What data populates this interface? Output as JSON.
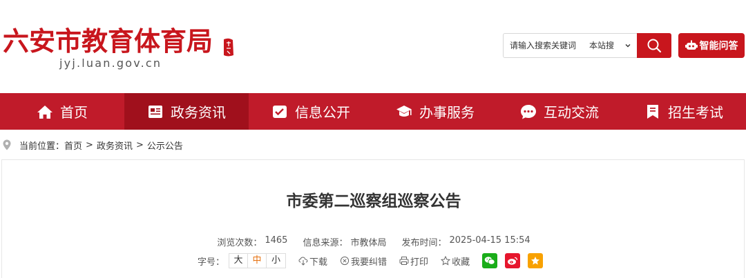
{
  "site": {
    "title": "六安市教育体育局",
    "url": "jyj.luan.gov.cn",
    "seal_text": "六安"
  },
  "search": {
    "placeholder": "请输入搜索关键词",
    "scope": "本站搜",
    "button_icon": "search-icon"
  },
  "ai_button": {
    "label": "智能问答",
    "icon": "robot-icon"
  },
  "nav": {
    "items": [
      {
        "label": "首页",
        "icon": "home-icon",
        "active": false
      },
      {
        "label": "政务资讯",
        "icon": "newspaper-icon",
        "active": true
      },
      {
        "label": "信息公开",
        "icon": "check-card-icon",
        "active": false
      },
      {
        "label": "办事服务",
        "icon": "graduation-cap-icon",
        "active": false
      },
      {
        "label": "互动交流",
        "icon": "chat-bubble-icon",
        "active": false
      },
      {
        "label": "招生考试",
        "icon": "bookmark-icon",
        "active": false
      }
    ]
  },
  "breadcrumb": {
    "prefix": "当前位置：",
    "items": [
      "首页",
      "政务资讯",
      "公示公告"
    ],
    "separator": ">"
  },
  "article": {
    "title": "市委第二巡察组巡察公告",
    "views_label": "浏览次数：",
    "views": "1465",
    "source_label": "信息来源：",
    "source": "市教体局",
    "time_label": "发布时间：",
    "time": "2025-04-15 15:54"
  },
  "tools": {
    "font_size_label": "字号：",
    "font_sizes": [
      "大",
      "中",
      "小"
    ],
    "font_size_selected": "中",
    "download": "下载",
    "correct": "我要纠错",
    "print": "打印",
    "favorite": "收藏",
    "share": [
      {
        "name": "wechat",
        "color": "#1aad19"
      },
      {
        "name": "weibo",
        "color": "#e6162d"
      },
      {
        "name": "qzone",
        "color": "#f8a100"
      }
    ]
  },
  "colors": {
    "brand_red": "#c8161d",
    "nav_bg": "#c01b2a",
    "nav_active": "#a0101c",
    "font_size_active": "#e6700e"
  }
}
